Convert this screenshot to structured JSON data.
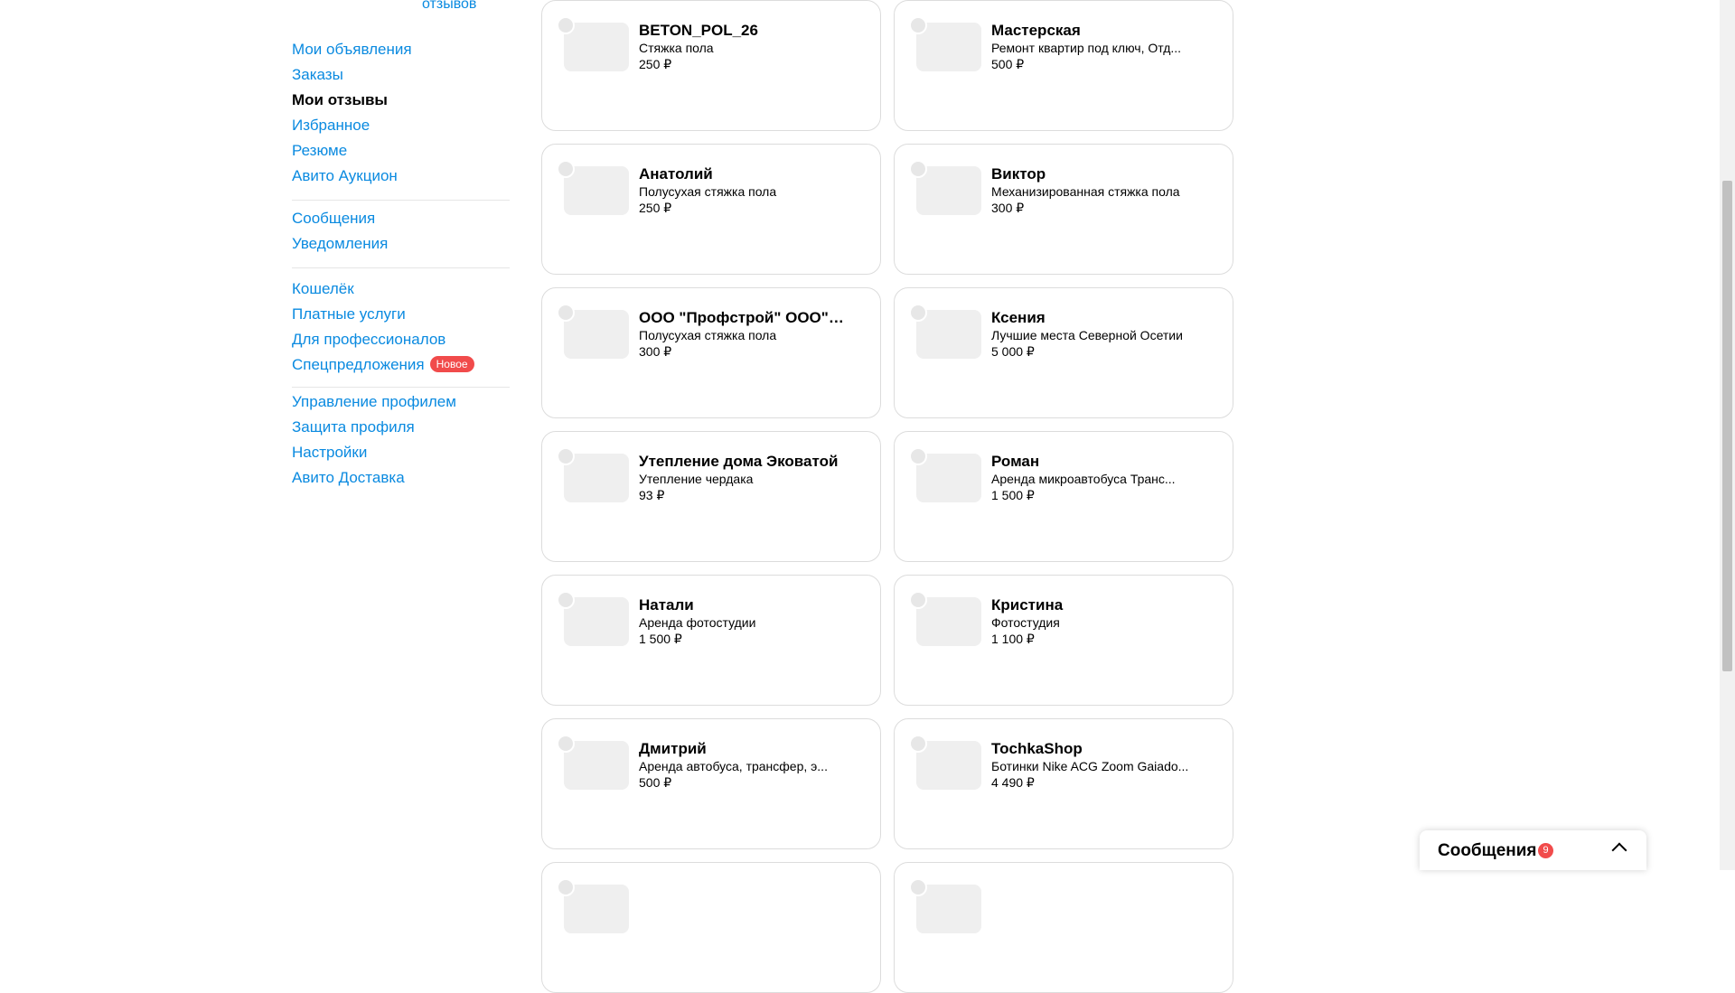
{
  "sidebar": {
    "reviews_count_label": "отзывов",
    "groups": [
      [
        "Мои объявления",
        "Заказы",
        "Мои отзывы",
        "Избранное",
        "Резюме",
        "Авито Аукцион"
      ],
      [
        "Сообщения",
        "Уведомления"
      ],
      [
        "Кошелёк",
        "Платные услуги",
        "Для профессионалов",
        "Спецпредложения"
      ],
      [
        "Управление профилем",
        "Защита профиля",
        "Настройки",
        "Авито Доставка"
      ]
    ],
    "active_item": "Мои отзывы",
    "new_badge": "Новое"
  },
  "cards": [
    {
      "title": "BETON_POL_26",
      "subtitle": "Стяжка пола",
      "price": "250 ₽"
    },
    {
      "title": "Мастерская",
      "subtitle": "Ремонт квартир под ключ, Отд...",
      "price": "500 ₽"
    },
    {
      "title": "Анатолий",
      "subtitle": "Полусухая стяжка пола",
      "price": "250 ₽"
    },
    {
      "title": "Виктор",
      "subtitle": "Механизированная стяжка пола",
      "price": "300 ₽"
    },
    {
      "title": "ООО \"Профстрой\" ООО\"П...",
      "subtitle": "Полусухая стяжка пола",
      "price": "300 ₽"
    },
    {
      "title": "Ксения",
      "subtitle": "Лучшие места Северной Осетии",
      "price": "5 000 ₽"
    },
    {
      "title": "Утепление дома Эковатой",
      "subtitle": "Утепление чердака",
      "price": "93 ₽"
    },
    {
      "title": "Роман",
      "subtitle": "Аренда микроавтобуса Транс...",
      "price": "1 500 ₽"
    },
    {
      "title": "Натали",
      "subtitle": "Аренда фотостудии",
      "price": "1 500 ₽"
    },
    {
      "title": "Кристина",
      "subtitle": "Фотостудия",
      "price": "1 100 ₽"
    },
    {
      "title": "Дмитрий",
      "subtitle": "Аренда автобуса, трансфер, э...",
      "price": "500 ₽"
    },
    {
      "title": "TochkaShop",
      "subtitle": "Ботинки Nike ACG Zoom Gaiado...",
      "price": "4 490 ₽"
    },
    {
      "title": "",
      "subtitle": "",
      "price": ""
    },
    {
      "title": "",
      "subtitle": "",
      "price": ""
    }
  ],
  "messenger": {
    "title": "Сообщения",
    "unread": "9"
  },
  "colors": {
    "link": "#0a8ae0",
    "badge": "#f14b4b"
  }
}
